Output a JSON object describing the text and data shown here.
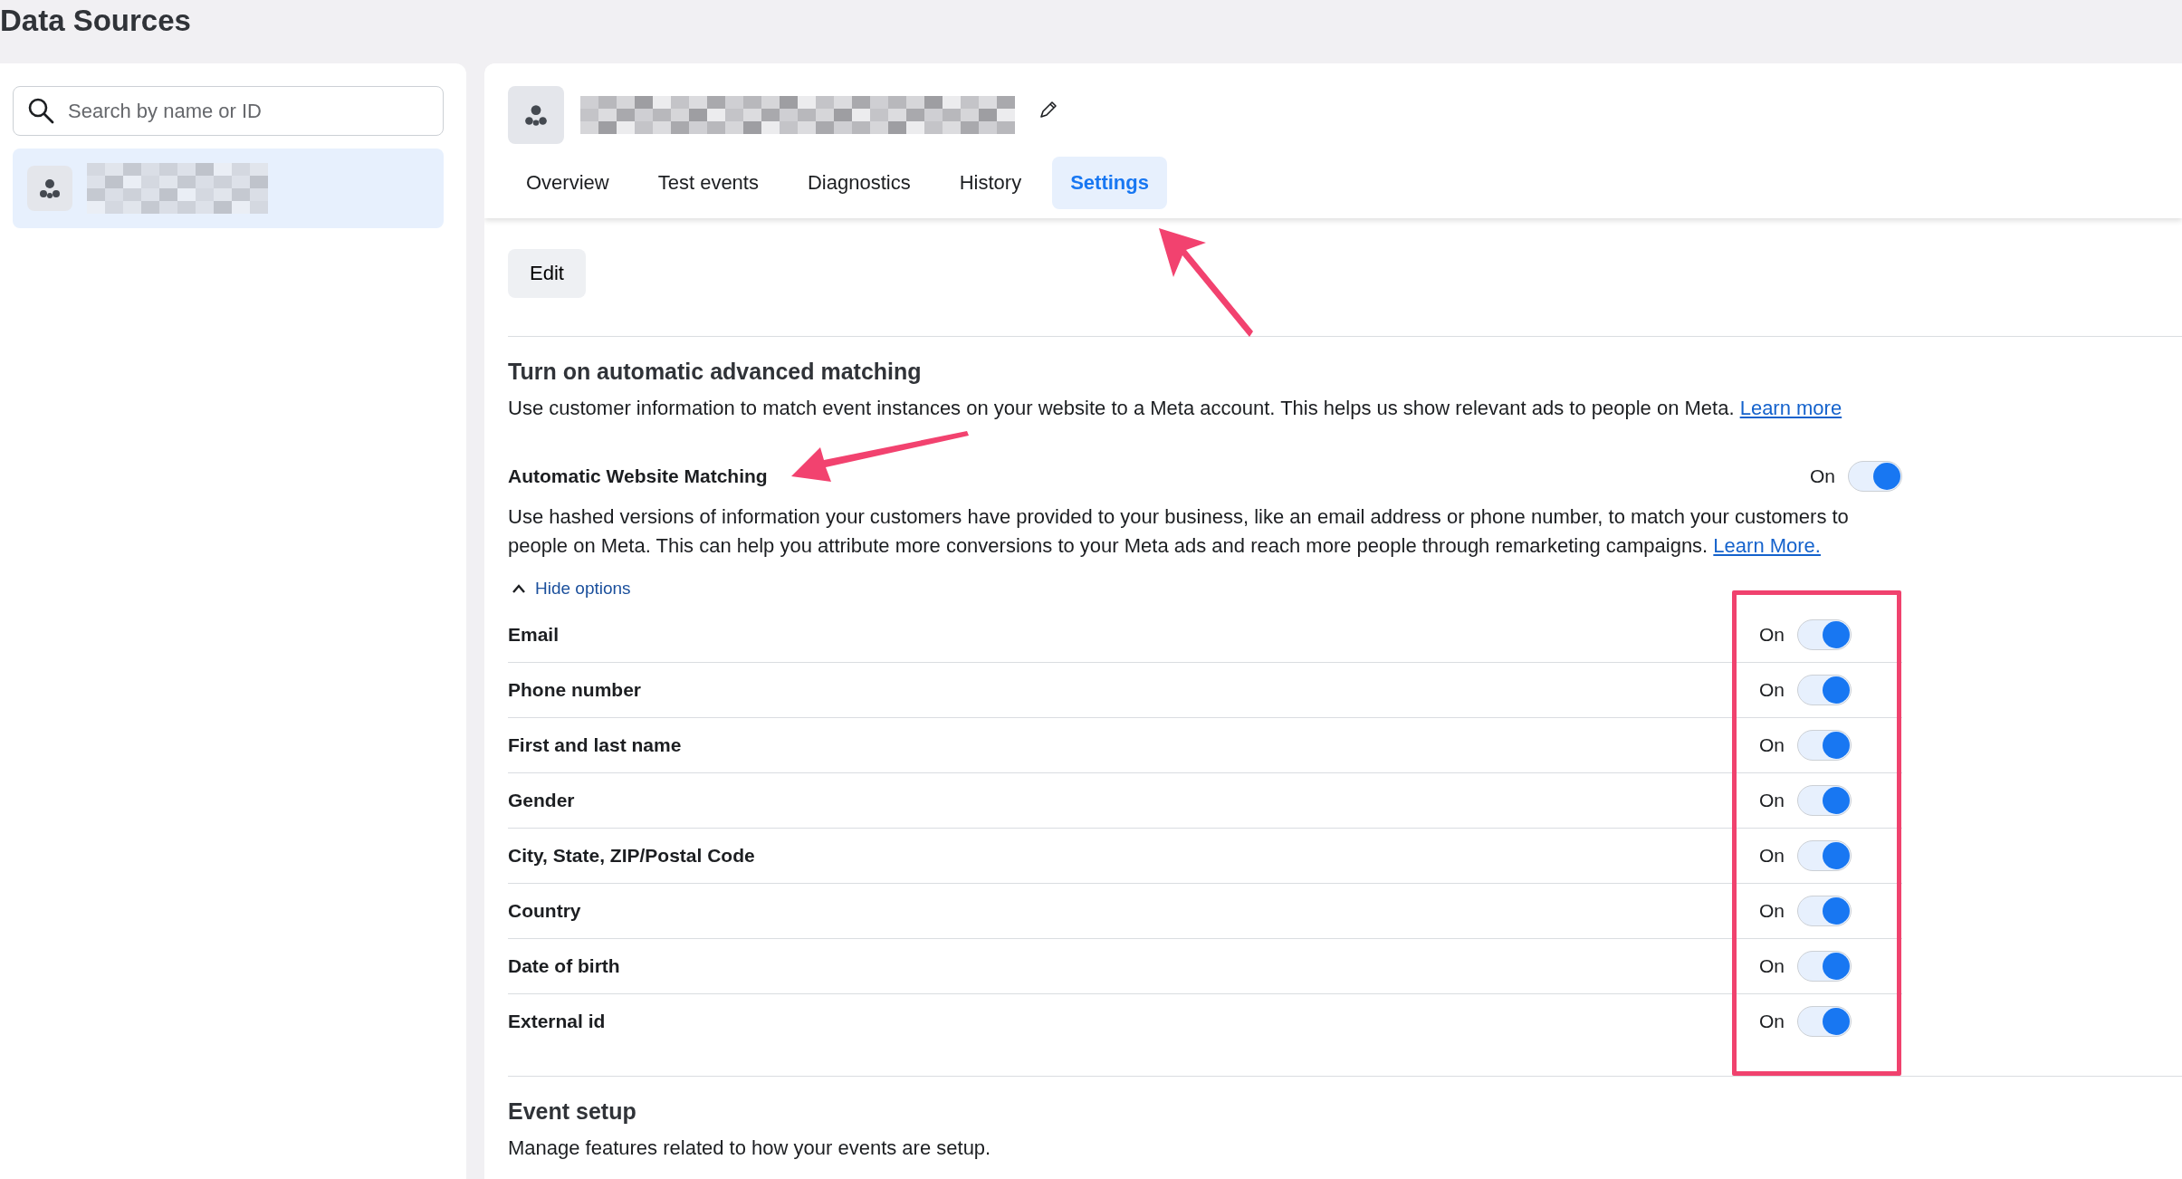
{
  "page_title": "Data Sources",
  "search": {
    "placeholder": "Search by name or ID"
  },
  "sources": [
    {
      "selected": true
    }
  ],
  "tabs": [
    {
      "label": "Overview",
      "selected": false
    },
    {
      "label": "Test events",
      "selected": false
    },
    {
      "label": "Diagnostics",
      "selected": false
    },
    {
      "label": "History",
      "selected": false
    },
    {
      "label": "Settings",
      "selected": true
    }
  ],
  "edit_button": "Edit",
  "advanced_matching": {
    "title": "Turn on automatic advanced matching",
    "description": "Use customer information to match event instances on your website to a Meta account. This helps us show relevant ads to people on Meta.",
    "link": "Learn more"
  },
  "website_matching": {
    "label": "Automatic Website Matching",
    "state_label": "On",
    "on": true,
    "description": "Use hashed versions of information your customers have provided to your business, like an email address or phone number, to match your customers to people on Meta. This can help you attribute more conversions to your Meta ads and reach more people through remarketing campaigns.",
    "link": "Learn More.",
    "options_toggle": "Hide options",
    "expanded": true,
    "fields": [
      {
        "label": "Email",
        "state_label": "On",
        "on": true
      },
      {
        "label": "Phone number",
        "state_label": "On",
        "on": true
      },
      {
        "label": "First and last name",
        "state_label": "On",
        "on": true
      },
      {
        "label": "Gender",
        "state_label": "On",
        "on": true
      },
      {
        "label": "City, State, ZIP/Postal Code",
        "state_label": "On",
        "on": true
      },
      {
        "label": "Country",
        "state_label": "On",
        "on": true
      },
      {
        "label": "Date of birth",
        "state_label": "On",
        "on": true
      },
      {
        "label": "External id",
        "state_label": "On",
        "on": true
      }
    ]
  },
  "event_setup": {
    "title": "Event setup",
    "description": "Manage features related to how your events are setup."
  }
}
